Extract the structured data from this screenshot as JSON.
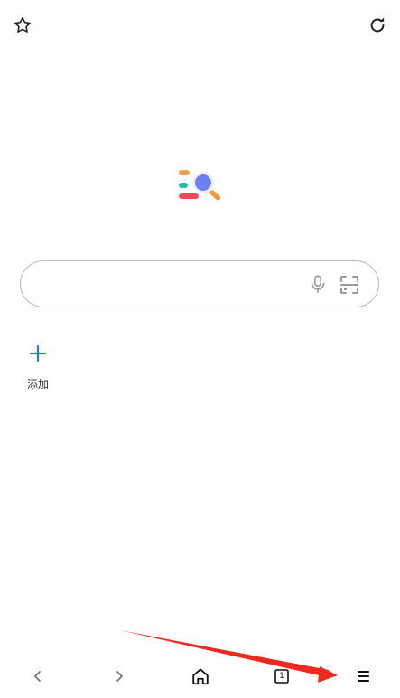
{
  "topbar": {
    "left_icon": "star-outline-icon",
    "right_icon": "refresh-icon"
  },
  "logo": {
    "name": "search-engine-logo",
    "colors": {
      "orange": "#f5a04d",
      "teal": "#1fc4a6",
      "red": "#ef4a5b",
      "blue": "#6d7ff5",
      "handle": "#f29a3b"
    }
  },
  "search": {
    "placeholder": "",
    "value": "",
    "mic_icon": "microphone-icon",
    "scan_icon": "qr-scan-icon"
  },
  "shortcuts": [
    {
      "icon": "plus-icon",
      "label": "添加",
      "color": "#2a7ae2"
    }
  ],
  "bottom_nav": {
    "back_icon": "chevron-left-icon",
    "forward_icon": "chevron-right-icon",
    "home_icon": "home-icon",
    "tabs_icon": "tabs-icon",
    "tabs_count": "1",
    "menu_icon": "menu-icon"
  },
  "annotation": {
    "type": "arrow",
    "color": "#ee2a1e",
    "target": "menu-button"
  }
}
